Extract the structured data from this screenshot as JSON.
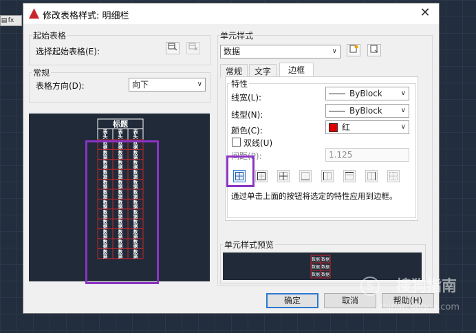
{
  "window": {
    "title": "修改表格样式: 明细栏",
    "close": "✕"
  },
  "start_table": {
    "group_label": "起始表格",
    "select_label": "选择起始表格(E):"
  },
  "general": {
    "group_label": "常规",
    "direction_label": "表格方向(D):",
    "direction_value": "向下"
  },
  "preview": {
    "title": "标题",
    "header": [
      "表头",
      "表头",
      "表头"
    ],
    "data_cell": "数据",
    "row_count": 12
  },
  "cell_style": {
    "group_label": "单元样式",
    "selected": "数据",
    "tabs": [
      "常规",
      "文字",
      "边框"
    ],
    "active_tab": "边框"
  },
  "border_tab": {
    "section_label": "特性",
    "lineweight_label": "线宽(L):",
    "lineweight_value": "ByBlock",
    "linetype_label": "线型(N):",
    "linetype_value": "ByBlock",
    "color_label": "颜色(C):",
    "color_value": "红",
    "color_swatch": "#e00000",
    "double_line_label": "双线(U)",
    "spacing_label": "间距(P):",
    "spacing_value": "1.125",
    "hint": "通过单击上面的按钮将选定的特性应用到边框。"
  },
  "cell_preview": {
    "group_label": "单元样式预览",
    "cell_text": "数据"
  },
  "buttons": {
    "ok": "确定",
    "cancel": "取消",
    "help": "帮助(H)"
  },
  "watermark": {
    "brand": "搜狗指南",
    "url": "zhinan.sogou.com",
    "logo": "S"
  },
  "mini_toolbar": {
    "fx": "fx"
  },
  "colors": {
    "highlight": "#8b33c5",
    "table_border": "#c2262c",
    "accent": "#2b78d1"
  }
}
